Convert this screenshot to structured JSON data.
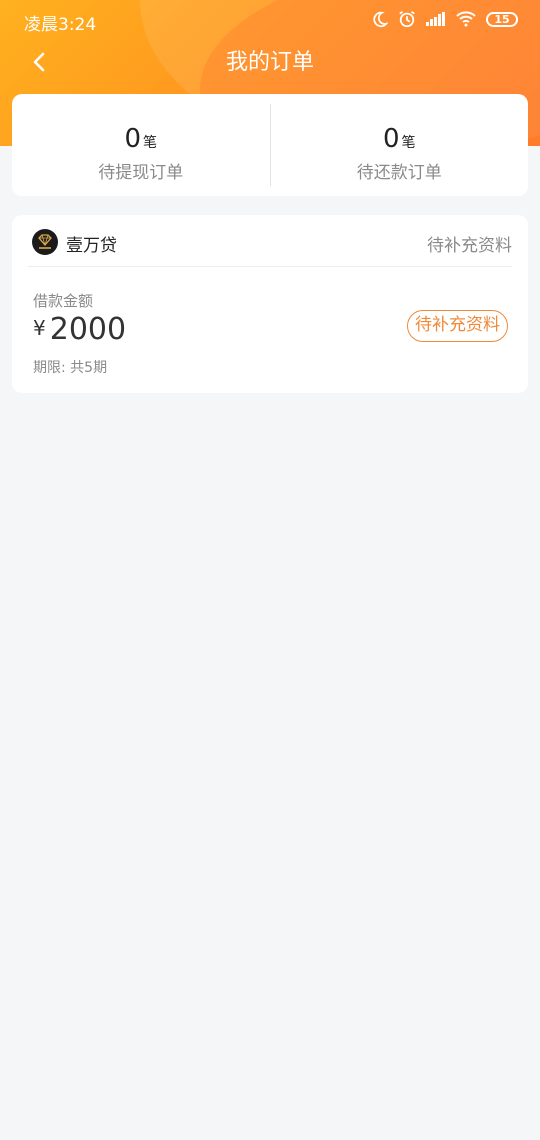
{
  "status_bar": {
    "time": "凌晨3:24",
    "icons": [
      "moon-icon",
      "alarm-icon",
      "signal-icon",
      "wifi-icon",
      "battery-icon"
    ],
    "battery_level": "15"
  },
  "nav": {
    "title": "我的订单",
    "back_icon": "chevron-left-icon"
  },
  "summary": {
    "items": [
      {
        "count": "0",
        "unit": "笔",
        "label": "待提现订单"
      },
      {
        "count": "0",
        "unit": "笔",
        "label": "待还款订单"
      }
    ]
  },
  "order": {
    "lender_name": "壹万贷",
    "lender_logo_icon": "diamond-logo-icon",
    "head_status": "待补充资料",
    "amount_label": "借款金额",
    "currency_symbol": "¥",
    "amount": "2000",
    "term": "期限: 共5期",
    "action_label": "待补充资料"
  },
  "colors": {
    "header_gradient_start": "#ffb11f",
    "header_gradient_end": "#ff7d2a",
    "accent": "#f08a3a",
    "background": "#f5f6f8"
  }
}
